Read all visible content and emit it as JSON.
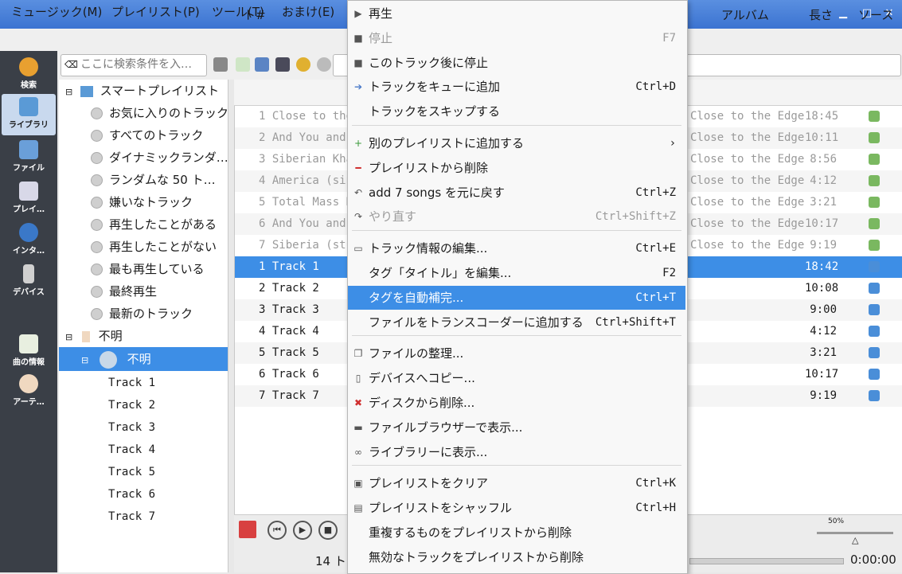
{
  "menubar": [
    "ミュージック(M)",
    "プレイリスト(P)",
    "ツール(T)",
    "おまけ(E)"
  ],
  "sidebar": [
    {
      "label": "検索",
      "icon": "search-icon"
    },
    {
      "label": "ライブラリ",
      "icon": "library-icon"
    },
    {
      "label": "ファイル",
      "icon": "files-icon"
    },
    {
      "label": "プレイ…",
      "icon": "playlists-icon"
    },
    {
      "label": "インタ…",
      "icon": "internet-icon"
    },
    {
      "label": "デバイス",
      "icon": "devices-icon"
    },
    {
      "label": "曲の情報",
      "icon": "song-info-icon"
    },
    {
      "label": "アーテ…",
      "icon": "artist-info-icon"
    }
  ],
  "search": {
    "placeholder": "ここに検索条件を入…"
  },
  "tree": {
    "smart_playlist": "スマートプレイリスト",
    "smart_items": [
      "お気に入りのトラック",
      "すべてのトラック",
      "ダイナミックランダ…",
      "ランダムな 50 ト…",
      "嫌いなトラック",
      "再生したことがある",
      "再生したことがない",
      "最も再生している",
      "最終再生",
      "最新のトラック"
    ],
    "unknown_artist": "不明",
    "unknown_album": "不明",
    "tracks": [
      "Track 1",
      "Track 2",
      "Track 3",
      "Track 4",
      "Track 5",
      "Track 6",
      "Track 7"
    ]
  },
  "playlist": {
    "headers": {
      "num": "ト#",
      "album": "アルバム",
      "length": "長さ",
      "source": "ソース"
    },
    "rows": [
      {
        "title": "1 Close to the",
        "album": "Close to the Edge",
        "length": "18:45",
        "style": "grey"
      },
      {
        "title": "2 And You and",
        "album": "Close to the Edge",
        "length": "10:11",
        "style": "grey"
      },
      {
        "title": "3 Siberian Kha",
        "album": "Close to the Edge",
        "length": "8:56",
        "style": "grey"
      },
      {
        "title": "4 America (sin",
        "album": "Close to the Edge",
        "length": "4:12",
        "style": "grey"
      },
      {
        "title": "5 Total Mass R",
        "album": "Close to the Edge",
        "length": "3:21",
        "style": "grey"
      },
      {
        "title": "6 And You and",
        "album": "Close to the Edge",
        "length": "10:17",
        "style": "grey"
      },
      {
        "title": "7 Siberia (stu",
        "album": "Close to the Edge",
        "length": "9:19",
        "style": "grey"
      },
      {
        "title": "1 Track 1",
        "album": "",
        "length": "18:42",
        "style": "sel"
      },
      {
        "title": "2 Track 2",
        "album": "",
        "length": "10:08",
        "style": ""
      },
      {
        "title": "3 Track 3",
        "album": "",
        "length": "9:00",
        "style": ""
      },
      {
        "title": "4 Track 4",
        "album": "",
        "length": "4:12",
        "style": ""
      },
      {
        "title": "5 Track 5",
        "album": "",
        "length": "3:21",
        "style": ""
      },
      {
        "title": "6 Track 6",
        "album": "",
        "length": "10:17",
        "style": ""
      },
      {
        "title": "7 Track 7",
        "album": "",
        "length": "9:19",
        "style": ""
      }
    ]
  },
  "status": {
    "count": "14 ト",
    "time": "0:00:00",
    "volume": "50%"
  },
  "context_menu": [
    {
      "label": "再生",
      "shortcut": "",
      "icon": "play-icon",
      "glyph": "▶",
      "state": ""
    },
    {
      "label": "停止",
      "shortcut": "F7",
      "icon": "stop-icon",
      "glyph": "■",
      "state": "dis"
    },
    {
      "label": "このトラック後に停止",
      "shortcut": "",
      "icon": "stop-after-icon",
      "glyph": "■",
      "state": ""
    },
    {
      "label": "トラックをキューに追加",
      "shortcut": "Ctrl+D",
      "icon": "queue-icon",
      "glyph": "➔",
      "state": ""
    },
    {
      "label": "トラックをスキップする",
      "shortcut": "",
      "icon": "",
      "glyph": "",
      "state": "",
      "sep_after": true
    },
    {
      "label": "別のプレイリストに追加する",
      "shortcut": "›",
      "icon": "add-icon",
      "glyph": "+",
      "state": ""
    },
    {
      "label": "プレイリストから削除",
      "shortcut": "",
      "icon": "remove-icon",
      "glyph": "━",
      "state": ""
    },
    {
      "label": "add 7 songs を元に戻す",
      "shortcut": "Ctrl+Z",
      "icon": "undo-icon",
      "glyph": "↶",
      "state": ""
    },
    {
      "label": "やり直す",
      "shortcut": "Ctrl+Shift+Z",
      "icon": "redo-icon",
      "glyph": "↷",
      "state": "dis",
      "sep_after": true
    },
    {
      "label": "トラック情報の編集...",
      "shortcut": "Ctrl+E",
      "icon": "edit-info-icon",
      "glyph": "▭",
      "state": ""
    },
    {
      "label": "タグ「タイトル」を編集...",
      "shortcut": "F2",
      "icon": "",
      "glyph": "",
      "state": ""
    },
    {
      "label": "タグを自動補完...",
      "shortcut": "Ctrl+T",
      "icon": "",
      "glyph": "",
      "state": "hl"
    },
    {
      "label": "ファイルをトランスコーダーに追加する",
      "shortcut": "Ctrl+Shift+T",
      "icon": "",
      "glyph": "",
      "state": "",
      "sep_after": true
    },
    {
      "label": "ファイルの整理...",
      "shortcut": "",
      "icon": "organize-icon",
      "glyph": "❐",
      "state": ""
    },
    {
      "label": "デバイスへコピー...",
      "shortcut": "",
      "icon": "copy-device-icon",
      "glyph": "▯",
      "state": ""
    },
    {
      "label": "ディスクから削除...",
      "shortcut": "",
      "icon": "delete-icon",
      "glyph": "✖",
      "state": ""
    },
    {
      "label": "ファイルブラウザーで表示...",
      "shortcut": "",
      "icon": "folder-icon",
      "glyph": "▬",
      "state": ""
    },
    {
      "label": "ライブラリーに表示...",
      "shortcut": "",
      "icon": "binoculars-icon",
      "glyph": "∞",
      "state": "",
      "sep_after": true
    },
    {
      "label": "プレイリストをクリア",
      "shortcut": "Ctrl+K",
      "icon": "clear-icon",
      "glyph": "▣",
      "state": ""
    },
    {
      "label": "プレイリストをシャッフル",
      "shortcut": "Ctrl+H",
      "icon": "shuffle-icon",
      "glyph": "▤",
      "state": ""
    },
    {
      "label": "重複するものをプレイリストから削除",
      "shortcut": "",
      "icon": "",
      "glyph": "",
      "state": ""
    },
    {
      "label": "無効なトラックをプレイリストから削除",
      "shortcut": "",
      "icon": "",
      "glyph": "",
      "state": ""
    }
  ],
  "colors": {
    "accent": "#3d8ee6",
    "title_bar": "#3b73d1",
    "sidebar": "#3a3f47"
  }
}
